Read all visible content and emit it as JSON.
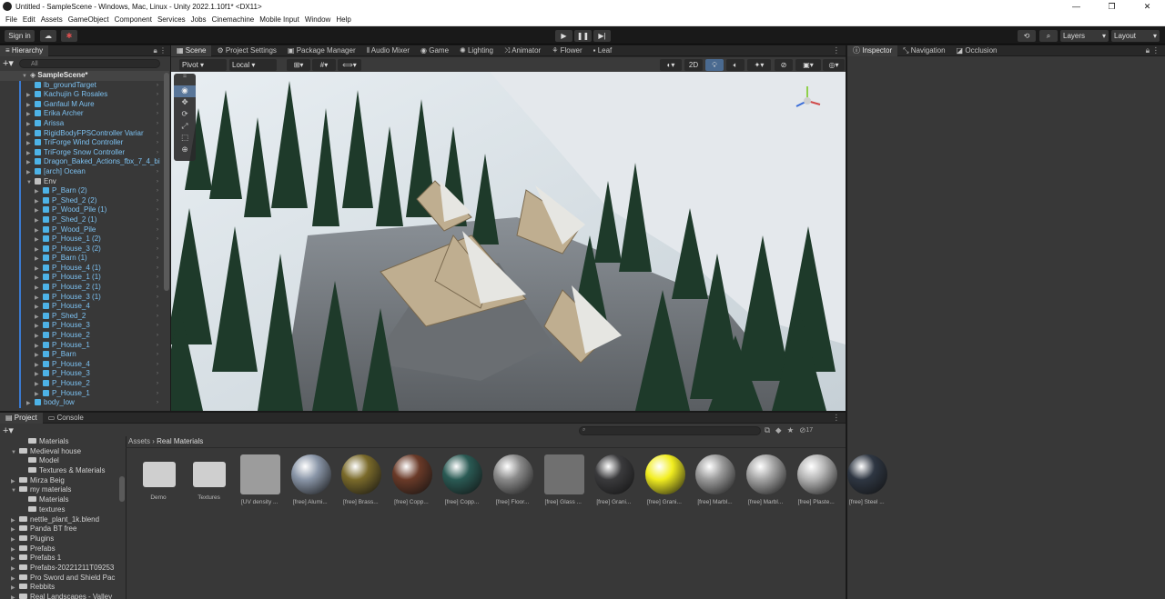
{
  "window": {
    "title": "Untitled - SampleScene - Windows, Mac, Linux - Unity 2022.1.10f1* <DX11>",
    "controls": [
      "—",
      "❐",
      "✕"
    ]
  },
  "menu": [
    "File",
    "Edit",
    "Assets",
    "GameObject",
    "Component",
    "Services",
    "Jobs",
    "Cinemachine",
    "Mobile Input",
    "Window",
    "Help"
  ],
  "toolbar": {
    "signin": "Sign in",
    "layers": "Layers",
    "layout": "Layout"
  },
  "hierarchy": {
    "tab": "Hierarchy",
    "search_placeholder": "All",
    "scene": "SampleScene*",
    "items": [
      {
        "label": "lb_groundTarget",
        "indent": 1,
        "arrow": ""
      },
      {
        "label": "Kachujin G Rosales",
        "indent": 1,
        "arrow": "▶"
      },
      {
        "label": "Ganfaul M Aure",
        "indent": 1,
        "arrow": "▶"
      },
      {
        "label": "Erika Archer",
        "indent": 1,
        "arrow": "▶"
      },
      {
        "label": "Arissa",
        "indent": 1,
        "arrow": "▶"
      },
      {
        "label": "RigidBodyFPSController Variar",
        "indent": 1,
        "arrow": "▶"
      },
      {
        "label": "TriForge Wind Controller",
        "indent": 1,
        "arrow": "▶"
      },
      {
        "label": "TriForge Snow Controller",
        "indent": 1,
        "arrow": "▶"
      },
      {
        "label": "Dragon_Baked_Actions_fbx_7_4_bi",
        "indent": 1,
        "arrow": "▶"
      },
      {
        "label": "[arch] Ocean",
        "indent": 1,
        "arrow": "▶"
      },
      {
        "label": "Env",
        "indent": 1,
        "arrow": "▼",
        "plain": true
      },
      {
        "label": "P_Barn (2)",
        "indent": 2,
        "arrow": "▶"
      },
      {
        "label": "P_Shed_2 (2)",
        "indent": 2,
        "arrow": "▶"
      },
      {
        "label": "P_Wood_Pile (1)",
        "indent": 2,
        "arrow": "▶"
      },
      {
        "label": "P_Shed_2 (1)",
        "indent": 2,
        "arrow": "▶"
      },
      {
        "label": "P_Wood_Pile",
        "indent": 2,
        "arrow": "▶"
      },
      {
        "label": "P_House_1 (2)",
        "indent": 2,
        "arrow": "▶"
      },
      {
        "label": "P_House_3 (2)",
        "indent": 2,
        "arrow": "▶"
      },
      {
        "label": "P_Barn (1)",
        "indent": 2,
        "arrow": "▶"
      },
      {
        "label": "P_House_4 (1)",
        "indent": 2,
        "arrow": "▶"
      },
      {
        "label": "P_House_1 (1)",
        "indent": 2,
        "arrow": "▶"
      },
      {
        "label": "P_House_2 (1)",
        "indent": 2,
        "arrow": "▶"
      },
      {
        "label": "P_House_3 (1)",
        "indent": 2,
        "arrow": "▶"
      },
      {
        "label": "P_House_4",
        "indent": 2,
        "arrow": "▶"
      },
      {
        "label": "P_Shed_2",
        "indent": 2,
        "arrow": "▶"
      },
      {
        "label": "P_House_3",
        "indent": 2,
        "arrow": "▶"
      },
      {
        "label": "P_House_2",
        "indent": 2,
        "arrow": "▶"
      },
      {
        "label": "P_House_1",
        "indent": 2,
        "arrow": "▶"
      },
      {
        "label": "P_Barn",
        "indent": 2,
        "arrow": "▶"
      },
      {
        "label": "P_House_4",
        "indent": 2,
        "arrow": "▶"
      },
      {
        "label": "P_House_3",
        "indent": 2,
        "arrow": "▶"
      },
      {
        "label": "P_House_2",
        "indent": 2,
        "arrow": "▶"
      },
      {
        "label": "P_House_1",
        "indent": 2,
        "arrow": "▶"
      },
      {
        "label": "body_low",
        "indent": 1,
        "arrow": "▶"
      }
    ]
  },
  "center_tabs": [
    "Scene",
    "Project Settings",
    "Package Manager",
    "Audio Mixer",
    "Game",
    "Lighting",
    "Animator",
    "Flower",
    "Leaf"
  ],
  "scene_toolbar": {
    "pivot": "Pivot",
    "local": "Local",
    "mode2d": "2D"
  },
  "inspector_tabs": [
    "Inspector",
    "Navigation",
    "Occlusion"
  ],
  "bottom_tabs": [
    "Project",
    "Console"
  ],
  "project": {
    "breadcrumb": [
      "Assets",
      "Real Materials"
    ],
    "hidden_count": "17",
    "tree": [
      {
        "label": "Materials",
        "indent": 1,
        "arrow": ""
      },
      {
        "label": "Medieval house",
        "indent": 0,
        "arrow": "▼"
      },
      {
        "label": "Model",
        "indent": 1,
        "arrow": ""
      },
      {
        "label": "Textures & Materials",
        "indent": 1,
        "arrow": ""
      },
      {
        "label": "Mirza Beig",
        "indent": 0,
        "arrow": "▶"
      },
      {
        "label": "my materials",
        "indent": 0,
        "arrow": "▼"
      },
      {
        "label": "Materials",
        "indent": 1,
        "arrow": ""
      },
      {
        "label": "textures",
        "indent": 1,
        "arrow": ""
      },
      {
        "label": "nettle_plant_1k.blend",
        "indent": 0,
        "arrow": "▶"
      },
      {
        "label": "Panda BT free",
        "indent": 0,
        "arrow": "▶"
      },
      {
        "label": "Plugins",
        "indent": 0,
        "arrow": "▶"
      },
      {
        "label": "Prefabs",
        "indent": 0,
        "arrow": "▶"
      },
      {
        "label": "Prefabs 1",
        "indent": 0,
        "arrow": "▶"
      },
      {
        "label": "Prefabs-20221211T09253",
        "indent": 0,
        "arrow": "▶"
      },
      {
        "label": "Pro Sword and Shield Pac",
        "indent": 0,
        "arrow": "▶"
      },
      {
        "label": "Rebbits",
        "indent": 0,
        "arrow": "▶"
      },
      {
        "label": "Real Landscapes - Valley",
        "indent": 0,
        "arrow": "▶"
      }
    ],
    "assets": [
      {
        "label": "Demo",
        "kind": "folder"
      },
      {
        "label": "Textures",
        "kind": "folder"
      },
      {
        "label": "[UV density ...",
        "kind": "flat",
        "color": "#9c9c9c"
      },
      {
        "label": "[free] Alumi...",
        "kind": "sphere",
        "color": "#8a96a8"
      },
      {
        "label": "[free] Brass...",
        "kind": "sphere",
        "color": "#7a6a2a"
      },
      {
        "label": "[free] Copp...",
        "kind": "sphere",
        "color": "#6a3a28"
      },
      {
        "label": "[free] Copp...",
        "kind": "sphere",
        "color": "#2a5a54"
      },
      {
        "label": "[free] Floor...",
        "kind": "sphere",
        "color": "#8a8a8a"
      },
      {
        "label": "[free] Glass ...",
        "kind": "flat",
        "color": "#707070"
      },
      {
        "label": "[free] Grani...",
        "kind": "sphere",
        "color": "#3a3a3c"
      },
      {
        "label": "[free] Grani...",
        "kind": "sphere",
        "color": "#f2ee20"
      },
      {
        "label": "[free] Marbl...",
        "kind": "sphere",
        "color": "#9a9a9a"
      },
      {
        "label": "[free] Marbl...",
        "kind": "sphere",
        "color": "#a4a4a4"
      },
      {
        "label": "[free] Plaste...",
        "kind": "sphere",
        "color": "#b4b4b4"
      },
      {
        "label": "[free] Steel ...",
        "kind": "sphere",
        "color": "#2e3642"
      }
    ]
  }
}
